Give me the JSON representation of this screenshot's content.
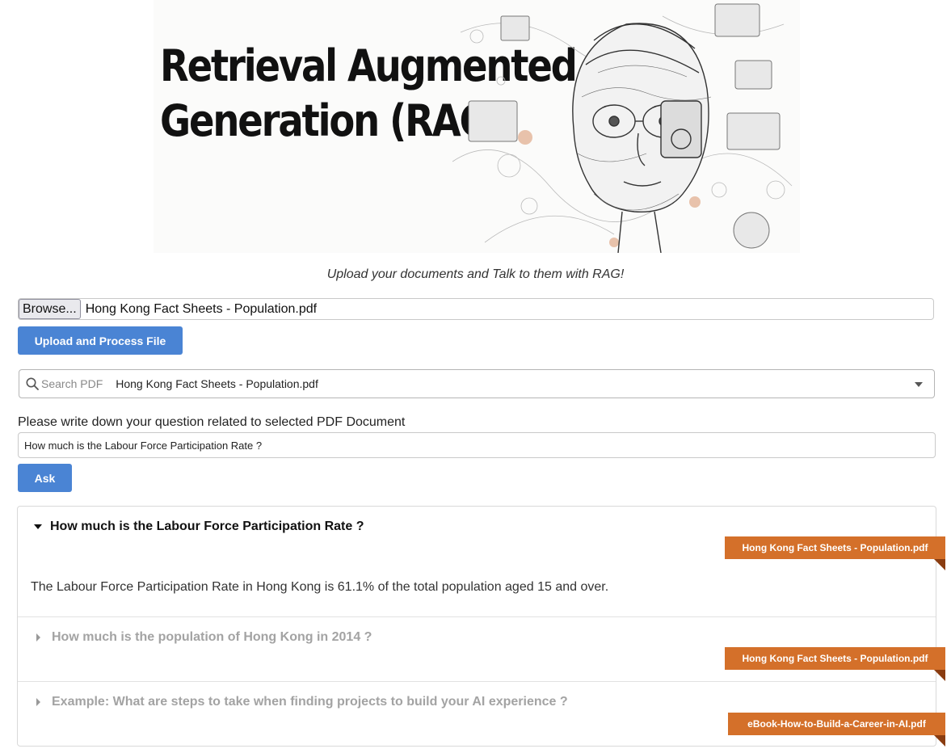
{
  "banner": {
    "title_line1": "Retrieval Augmented",
    "title_line2": "Generation (RAG)"
  },
  "tagline": "Upload your documents and Talk to them with RAG!",
  "upload": {
    "browse_label": "Browse...",
    "file_name": "Hong Kong Fact Sheets - Population.pdf",
    "button_label": "Upload and Process File"
  },
  "pdf_select": {
    "search_label": "Search PDF",
    "selected": "Hong Kong Fact Sheets - Population.pdf"
  },
  "question": {
    "label": "Please write down your question related to selected PDF Document",
    "value": "How much is the Labour Force Participation Rate ?",
    "ask_label": "Ask"
  },
  "history": [
    {
      "question": "How much is the Labour Force Participation Rate ?",
      "source": "Hong Kong Fact Sheets - Population.pdf",
      "answer": "The Labour Force Participation Rate in Hong Kong is 61.1% of the total population aged 15 and over.",
      "expanded": true
    },
    {
      "question": "How much is the population of Hong Kong in 2014 ?",
      "source": "Hong Kong Fact Sheets - Population.pdf",
      "expanded": false
    },
    {
      "question": "Example: What are steps to take when finding projects to build your AI experience ?",
      "source": "eBook-How-to-Build-a-Career-in-AI.pdf",
      "expanded": false
    }
  ],
  "colors": {
    "primary_button": "#4a84d4",
    "source_ribbon": "#d4702a"
  }
}
